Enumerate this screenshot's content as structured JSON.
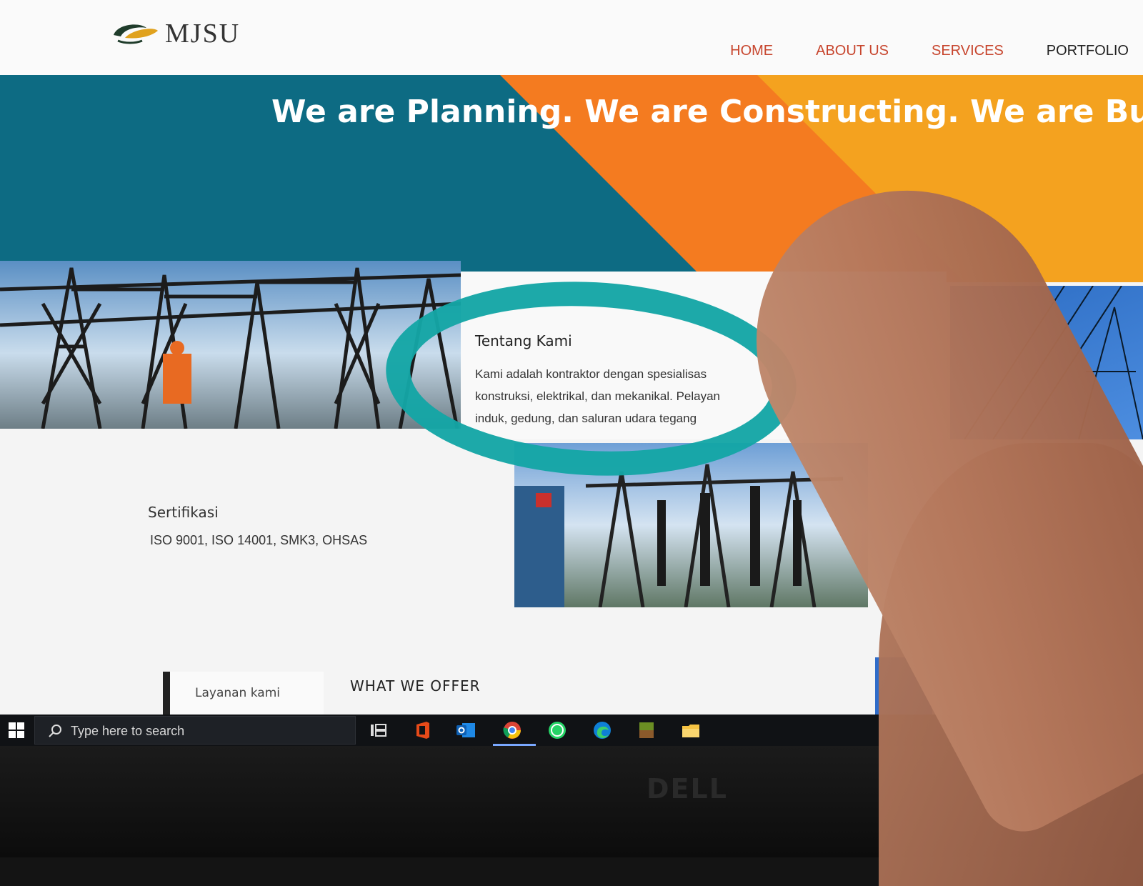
{
  "header": {
    "logo_text": "MJSU",
    "nav": [
      "HOME",
      "ABOUT US",
      "SERVICES",
      "PORTFOLIO"
    ]
  },
  "hero": {
    "title": "We are Planning. We are Constructing. We are Building"
  },
  "about": {
    "heading": "Tentang Kami",
    "lines": [
      "Kami adalah kontraktor dengan spesialisas",
      "konstruksi, elektrikal, dan mekanikal. Pelayan",
      "induk, gedung, dan saluran udara tegang"
    ]
  },
  "certification": {
    "heading": "Sertifikasi",
    "text": "ISO 9001, ISO 14001, SMK3, OHSAS"
  },
  "services_tab": {
    "label": "Layanan kami"
  },
  "offer": {
    "title": "WHAT WE OFFER"
  },
  "taskbar": {
    "search_placeholder": "Type here to search",
    "apps": [
      "task-view",
      "office",
      "outlook",
      "chrome",
      "whatsapp",
      "edge",
      "minecraft",
      "file-explorer"
    ]
  },
  "bezel": {
    "brand": "DELL"
  },
  "colors": {
    "hero_teal": "#0d6b83",
    "hero_orange": "#f47b20",
    "hero_yellow": "#f4a21f",
    "nav_accent": "#c7452d",
    "annotation": "#14a5a5"
  }
}
